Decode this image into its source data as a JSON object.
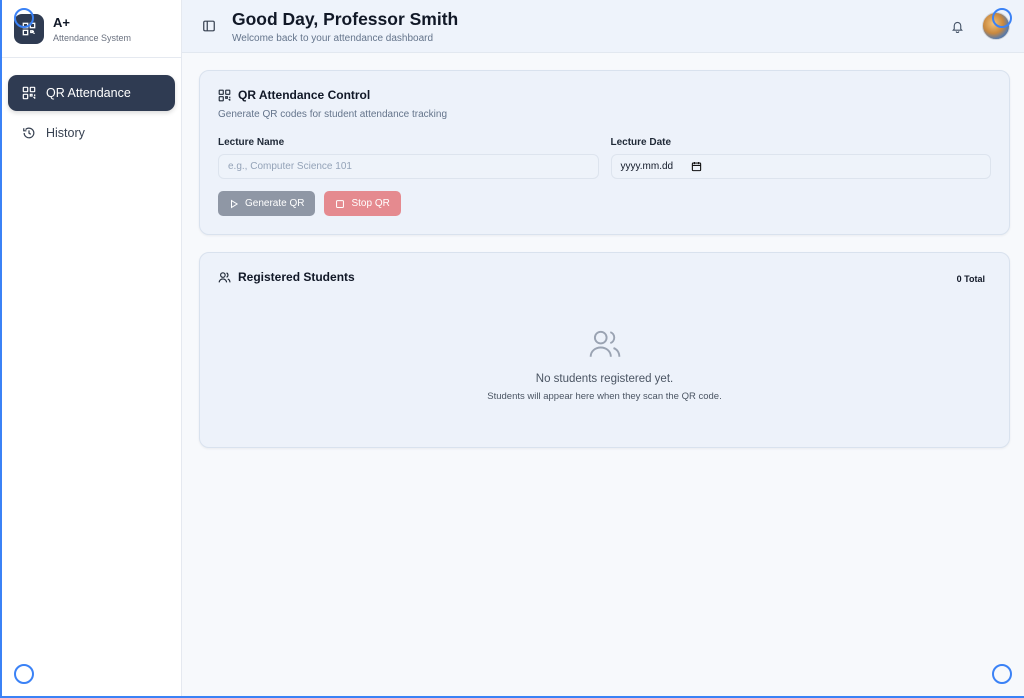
{
  "brand": {
    "name": "A+",
    "subtitle": "Attendance System"
  },
  "sidebar": {
    "items": [
      {
        "label": "QR Attendance",
        "icon": "qr-code-icon",
        "active": true
      },
      {
        "label": "History",
        "icon": "history-icon",
        "active": false
      }
    ]
  },
  "header": {
    "title": "Good Day, Professor Smith",
    "subtitle": "Welcome back to your attendance dashboard"
  },
  "qr_card": {
    "title": "QR Attendance Control",
    "description": "Generate QR codes for student attendance tracking",
    "lecture_name_label": "Lecture Name",
    "lecture_name_placeholder": "e.g., Computer Science 101",
    "lecture_date_label": "Lecture Date",
    "lecture_date_placeholder": "yyyy.mm.dd",
    "generate_label": "Generate QR",
    "stop_label": "Stop QR"
  },
  "students_card": {
    "title": "Registered Students",
    "total": "0 Total",
    "empty_title": "No students registered yet.",
    "empty_subtitle": "Students will appear here when they scan the QR code."
  },
  "colors": {
    "sidebar_active": "#2f3b52",
    "generate_button": "#8f97a5",
    "stop_button": "#e58a8f",
    "accent_outline": "#3b82f6"
  }
}
